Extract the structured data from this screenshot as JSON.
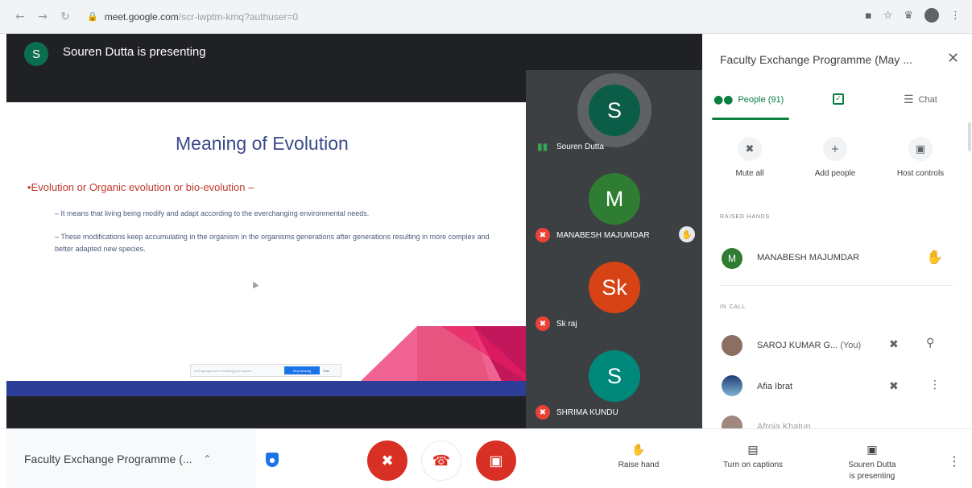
{
  "browser": {
    "url_host": "meet.google.com",
    "url_path": "/scr-iwptm-kmq?authuser=0"
  },
  "presenter": {
    "initial": "S",
    "text": "Souren Dutta is presenting"
  },
  "slide": {
    "title": "Meaning of Evolution",
    "bullet": "•Evolution or Organic evolution or bio-evolution –",
    "sub1": "– It means that living being modify and adapt according to the everchanging environmental needs.",
    "sub2": "– These modifications keep accumulating in the organism in the organisms generations after generations resulting in more complex and better adapted new species.",
    "share_text": "meet.google.com is sharing your screen.",
    "share_stop": "Stop sharing",
    "share_hide": "Hide"
  },
  "tiles": [
    {
      "initial": "S",
      "name": "Souren Dutta",
      "color": "#0b5d47"
    },
    {
      "initial": "M",
      "name": "MANABESH MAJUMDAR",
      "color": "#2e7d32"
    },
    {
      "initial": "Sk",
      "name": "Sk raj",
      "color": "#d84315"
    },
    {
      "initial": "S",
      "name": "SHRIMA KUNDU",
      "color": "#00897b"
    }
  ],
  "panel": {
    "title": "Faculty Exchange Programme (May ...",
    "tabs": {
      "people": "People (91)",
      "chat": "Chat"
    },
    "actions": {
      "mute_all": "Mute all",
      "add_people": "Add people",
      "host_controls": "Host controls"
    },
    "raised_hands_label": "RAISED HANDS",
    "raised": {
      "initial": "M",
      "name": "MANABESH MAJUMDAR",
      "color": "#2e7d32"
    },
    "in_call_label": "IN CALL",
    "in_call": [
      {
        "name": "SAROJ KUMAR G...",
        "you": "(You)"
      },
      {
        "name": "Afia Ibrat"
      },
      {
        "name": "Afroja Khatun"
      }
    ]
  },
  "bottom": {
    "meeting_name": "Faculty Exchange Programme (...",
    "raise_hand": "Raise hand",
    "captions": "Turn on captions",
    "presenting_line1": "Souren Dutta",
    "presenting_line2": "is presenting"
  },
  "colors": {
    "accent_green": "#0b8043",
    "danger_red": "#d93025",
    "slide_footer": "#2c3e97"
  }
}
